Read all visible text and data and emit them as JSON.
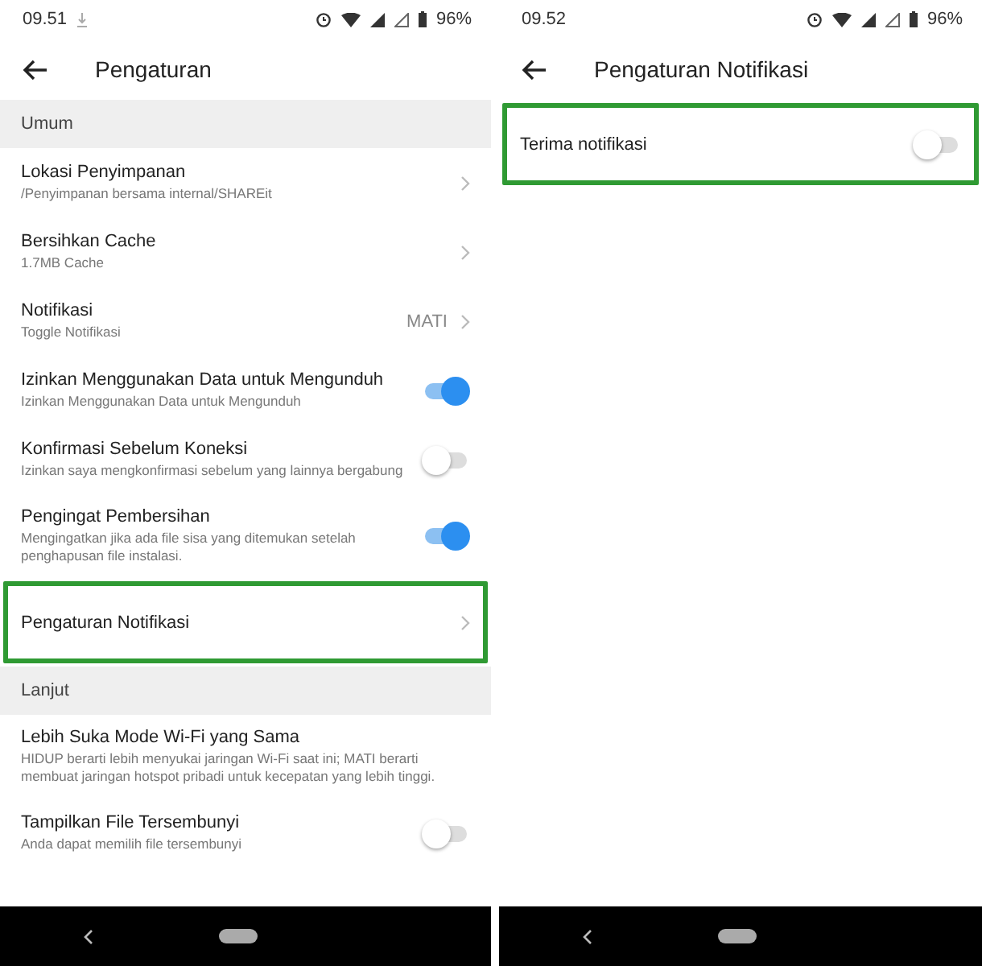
{
  "screens": [
    {
      "status_bar": {
        "time": "09.51",
        "battery": "96%"
      },
      "title": "Pengaturan",
      "sections": [
        {
          "header": "Umum",
          "rows": [
            {
              "kind": "link",
              "title": "Lokasi Penyimpanan",
              "subtitle": "/Penyimpanan bersama internal/SHAREit",
              "highlighted": false
            },
            {
              "kind": "link",
              "title": "Bersihkan Cache",
              "subtitle": "1.7MB Cache",
              "highlighted": false
            },
            {
              "kind": "link",
              "title": "Notifikasi",
              "subtitle": "Toggle Notifikasi",
              "value": "MATI",
              "highlighted": false
            },
            {
              "kind": "toggle",
              "title": "Izinkan Menggunakan Data untuk Mengunduh",
              "subtitle": "Izinkan Menggunakan Data untuk Mengunduh",
              "on": true,
              "highlighted": false
            },
            {
              "kind": "toggle",
              "title": "Konfirmasi Sebelum Koneksi",
              "subtitle": "Izinkan saya mengkonfirmasi sebelum yang lainnya bergabung",
              "on": false,
              "highlighted": false
            },
            {
              "kind": "toggle",
              "title": "Pengingat Pembersihan",
              "subtitle": "Mengingatkan jika ada file sisa yang ditemukan setelah penghapusan file instalasi.",
              "on": true,
              "highlighted": false
            },
            {
              "kind": "link",
              "title": "Pengaturan Notifikasi",
              "highlighted": true
            }
          ]
        },
        {
          "header": "Lanjut",
          "rows": [
            {
              "kind": "text",
              "title": "Lebih Suka Mode Wi-Fi yang Sama",
              "subtitle": "HIDUP berarti lebih menyukai jaringan Wi-Fi saat ini; MATI berarti membuat jaringan hotspot pribadi untuk kecepatan yang lebih tinggi.",
              "highlighted": false
            },
            {
              "kind": "toggle",
              "title": "Tampilkan File Tersembunyi",
              "subtitle": "Anda dapat memilih file tersembunyi",
              "on": false,
              "highlighted": false
            }
          ]
        }
      ]
    },
    {
      "status_bar": {
        "time": "09.52",
        "battery": "96%"
      },
      "title": "Pengaturan Notifikasi",
      "sections": [
        {
          "rows": [
            {
              "kind": "toggle",
              "title": "Terima notifikasi",
              "on": false,
              "highlighted": true
            }
          ]
        }
      ]
    }
  ]
}
